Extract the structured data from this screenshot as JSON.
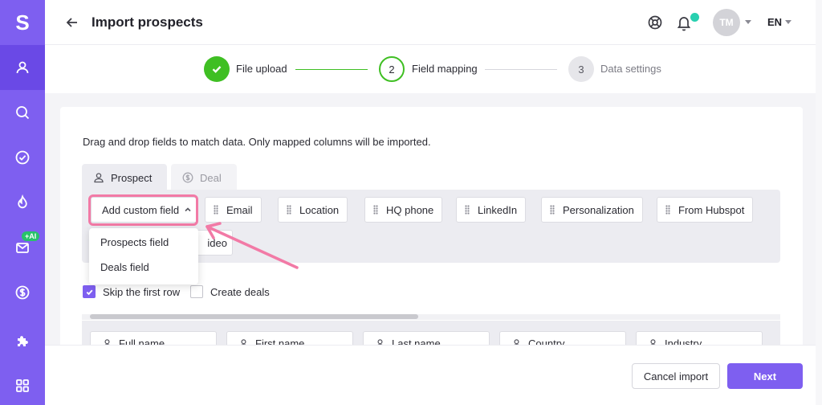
{
  "app": {
    "logo": "S"
  },
  "sidebar": {
    "items": [
      {
        "icon": "user-icon",
        "active": true
      },
      {
        "icon": "search-icon"
      },
      {
        "icon": "check-circle-icon"
      },
      {
        "icon": "flame-icon"
      },
      {
        "icon": "mail-icon",
        "badge": "+AI"
      },
      {
        "icon": "dollar-icon"
      },
      {
        "icon": "puzzle-icon"
      },
      {
        "icon": "apps-grid-icon"
      }
    ]
  },
  "header": {
    "title": "Import prospects",
    "avatar_initials": "TM",
    "language": "EN"
  },
  "stepper": {
    "steps": [
      {
        "number": "",
        "label": "File upload",
        "state": "done"
      },
      {
        "number": "2",
        "label": "Field mapping",
        "state": "current"
      },
      {
        "number": "3",
        "label": "Data settings",
        "state": "upcoming"
      }
    ]
  },
  "mapping": {
    "instructions": "Drag and drop fields to match data. Only mapped columns will be imported.",
    "tabs": [
      {
        "label": "Prospect",
        "icon": "user-icon",
        "active": true
      },
      {
        "label": "Deal",
        "icon": "dollar-icon",
        "active": false
      }
    ],
    "add_custom_field": "Add custom field",
    "fields": [
      "Email",
      "Location",
      "HQ phone",
      "LinkedIn",
      "Personalization",
      "From Hubspot"
    ],
    "partial_field": "ideo",
    "dropdown": [
      "Prospects field",
      "Deals field"
    ],
    "skip_first_row": {
      "label": "Skip the first row",
      "checked": true
    },
    "create_deals": {
      "label": "Create deals",
      "checked": false
    },
    "columns": [
      "Full name",
      "First name",
      "Last name",
      "Country",
      "Industry"
    ]
  },
  "footer": {
    "cancel": "Cancel import",
    "next": "Next"
  },
  "colors": {
    "accent": "#7e5ff0",
    "success": "#3fbf23",
    "highlight": "#f27aa6"
  }
}
